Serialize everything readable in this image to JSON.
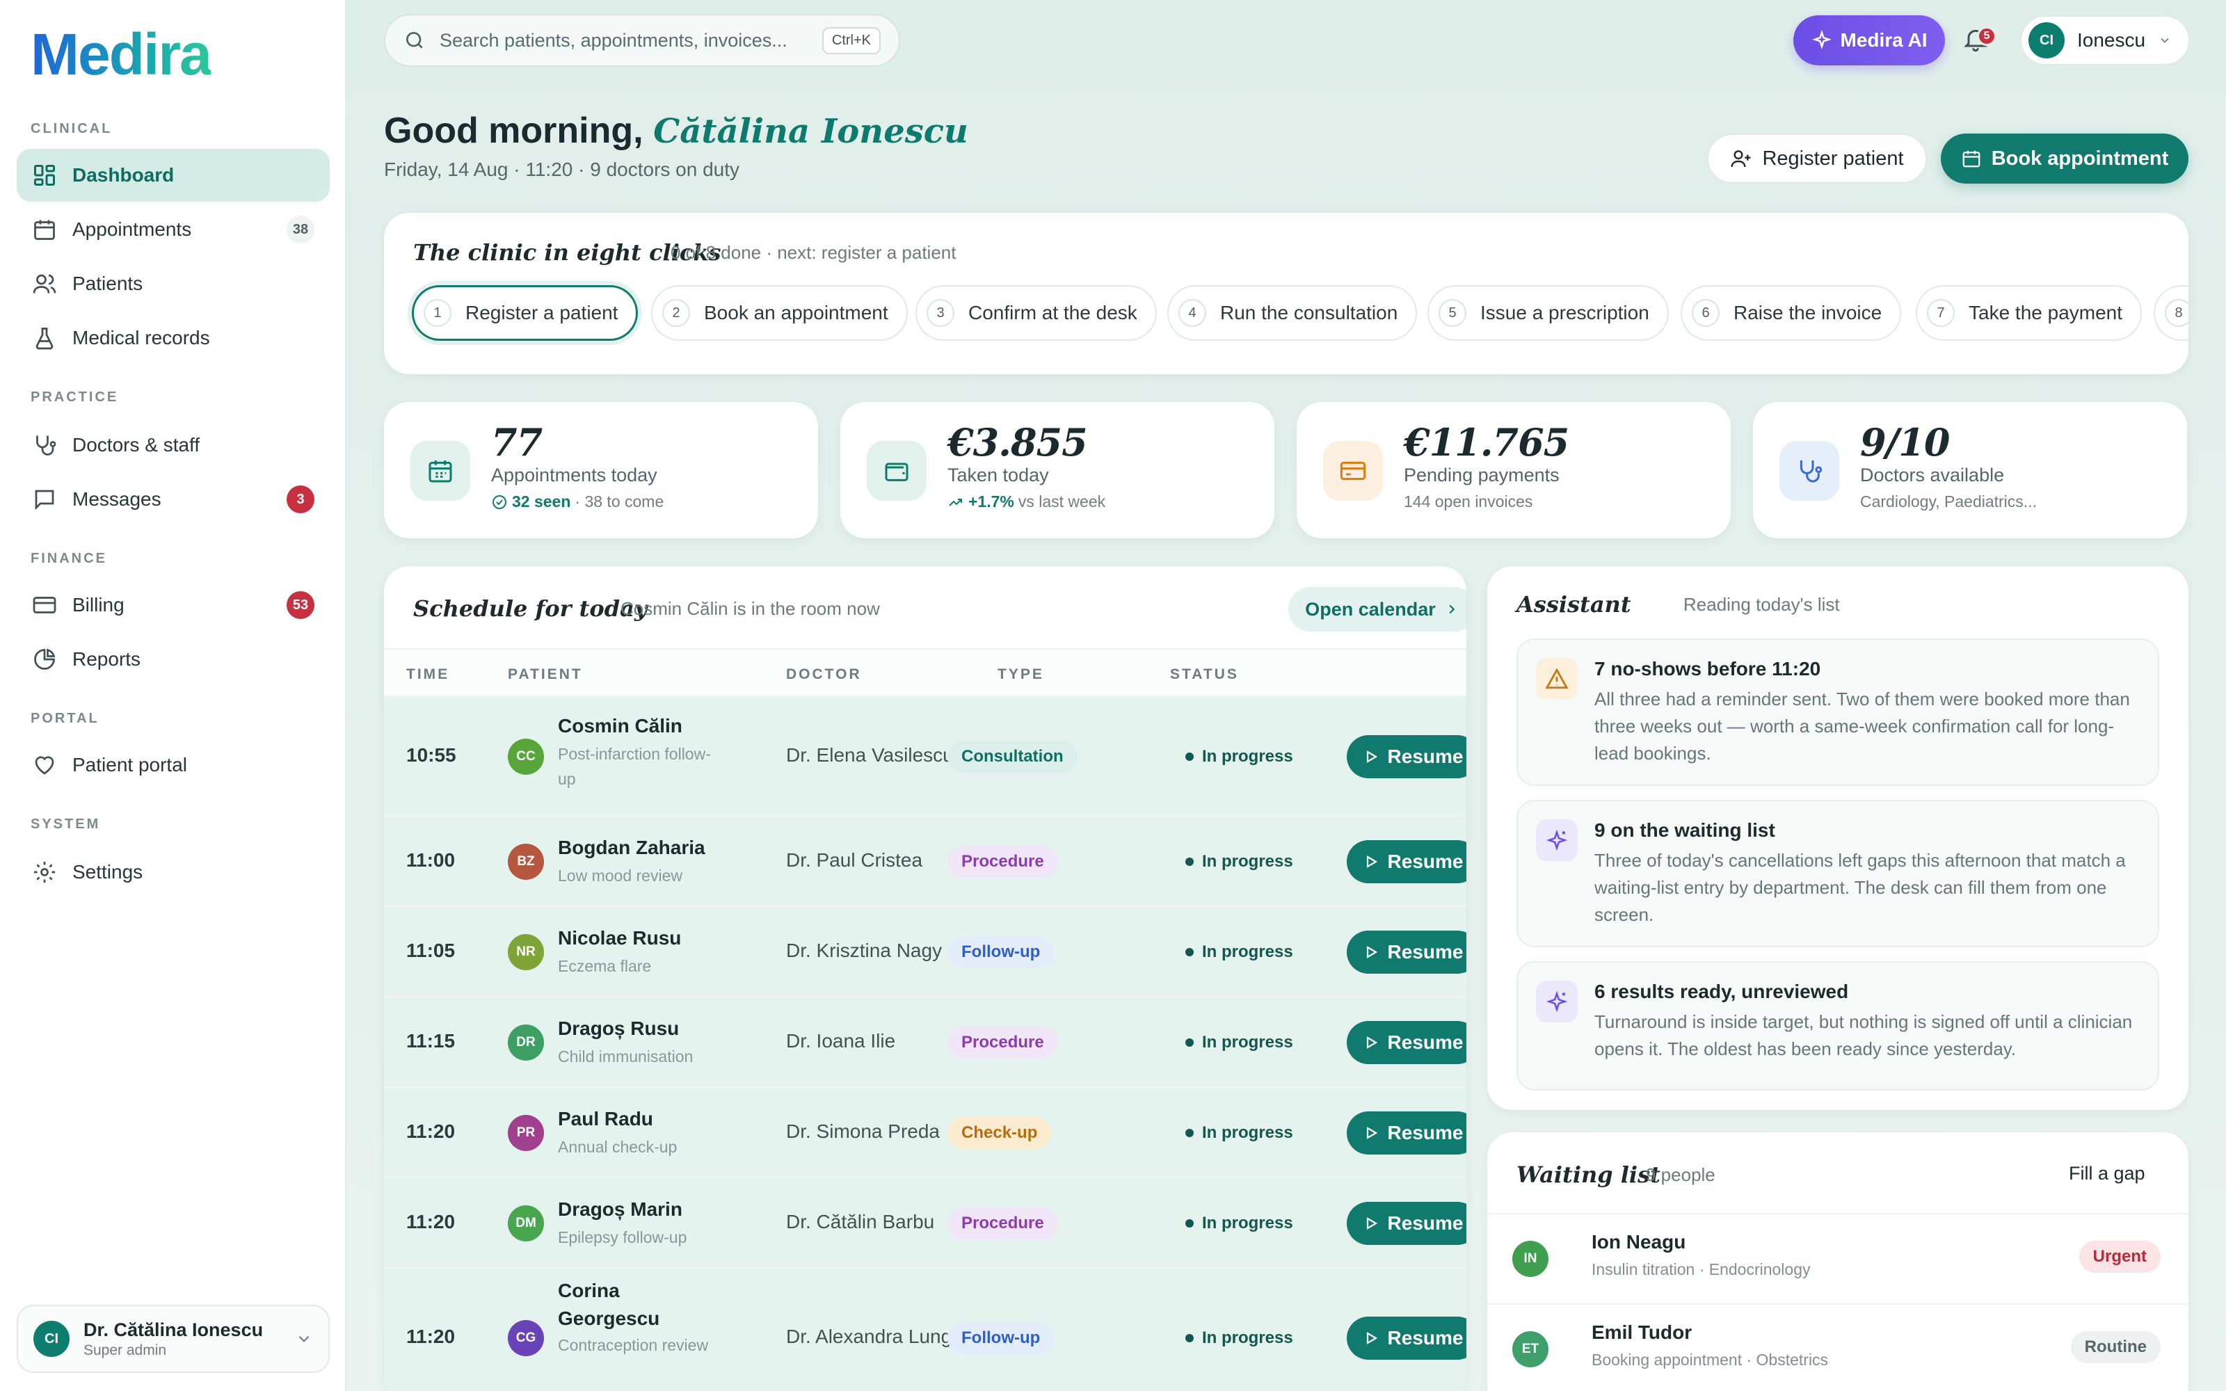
{
  "brand": "Medira",
  "sidebar": {
    "sections": [
      {
        "title": "CLINICAL",
        "items": [
          {
            "label": "Dashboard",
            "icon": "grid-icon",
            "active": true
          },
          {
            "label": "Appointments",
            "icon": "calendar-icon",
            "badge": "38"
          },
          {
            "label": "Patients",
            "icon": "users-icon"
          },
          {
            "label": "Medical records",
            "icon": "flask-icon"
          }
        ]
      },
      {
        "title": "PRACTICE",
        "items": [
          {
            "label": "Doctors & staff",
            "icon": "stethoscope-icon"
          },
          {
            "label": "Messages",
            "icon": "chat-icon",
            "badge": "3"
          }
        ]
      },
      {
        "title": "FINANCE",
        "items": [
          {
            "label": "Billing",
            "icon": "card-icon",
            "badge": "53"
          },
          {
            "label": "Reports",
            "icon": "pie-chart-icon"
          }
        ]
      },
      {
        "title": "PORTAL",
        "items": [
          {
            "label": "Patient portal",
            "icon": "heart-icon"
          }
        ]
      },
      {
        "title": "SYSTEM",
        "items": [
          {
            "label": "Settings",
            "icon": "gear-icon"
          }
        ]
      }
    ],
    "user": {
      "initials": "CI",
      "name": "Dr. Cătălina Ionescu",
      "role": "Super admin"
    }
  },
  "topbar": {
    "search_placeholder": "Search patients, appointments, invoices...",
    "shortcut": "Ctrl+K",
    "ai_label": "Medira AI",
    "notifications": "5",
    "user_initials": "CI",
    "user_name": "Ionescu"
  },
  "greeting": {
    "prefix": "Good morning,",
    "name": "Cătălina Ionescu",
    "subtitle": "Friday, 14 Aug · 11:20 · 9 doctors on duty",
    "register_label": "Register patient",
    "book_label": "Book appointment"
  },
  "steps": {
    "title": "The clinic in eight clicks",
    "subtitle": "0 of 8 done · next: register a patient",
    "items": [
      {
        "num": "1",
        "label": "Register a patient"
      },
      {
        "num": "2",
        "label": "Book an appointment"
      },
      {
        "num": "3",
        "label": "Confirm at the desk"
      },
      {
        "num": "4",
        "label": "Run the consultation"
      },
      {
        "num": "5",
        "label": "Issue a prescription"
      },
      {
        "num": "6",
        "label": "Raise the invoice"
      },
      {
        "num": "7",
        "label": "Take the payment"
      },
      {
        "num": "8",
        "label": ""
      }
    ]
  },
  "kpis": [
    {
      "value": "77",
      "label": "Appointments today",
      "sub_strong": "32 seen",
      "sub": "· 38 to come",
      "icon": "calendar-icon",
      "color": "#0f7a6d",
      "bg": "#e1f1ec"
    },
    {
      "value": "€3.855",
      "label": "Taken today",
      "sub_strong": "+1.7%",
      "sub": "vs last week",
      "icon": "wallet-icon",
      "color": "#0f7a6d",
      "bg": "#e1f1ec"
    },
    {
      "value": "€11.765",
      "label": "Pending payments",
      "sub_strong": "",
      "sub": "144 open invoices",
      "icon": "card-icon",
      "color": "#d97c16",
      "bg": "#fcefdf"
    },
    {
      "value": "9/10",
      "label": "Doctors available",
      "sub_strong": "",
      "sub": "Cardiology, Paediatrics...",
      "icon": "stethoscope-icon",
      "color": "#3569d4",
      "bg": "#e6eefc"
    }
  ],
  "schedule": {
    "title": "Schedule for today",
    "subtitle": "Cosmin Călin is in the room now",
    "open_calendar": "Open calendar",
    "columns": [
      "TIME",
      "PATIENT",
      "DOCTOR",
      "TYPE",
      "STATUS"
    ],
    "rows": [
      {
        "time": "10:55",
        "initials": "CC",
        "avatar_color": "#57a63a",
        "name": "Cosmin Călin",
        "note": "Post-infarction follow-up",
        "doctor": "Dr. Elena Vasilescu",
        "type": "Consultation",
        "type_kind": "consult",
        "status": "In progress",
        "action": "Resume"
      },
      {
        "time": "11:00",
        "initials": "BZ",
        "avatar_color": "#b5583f",
        "name": "Bogdan Zaharia",
        "note": "Low mood review",
        "doctor": "Dr. Paul Cristea",
        "type": "Procedure",
        "type_kind": "proc",
        "status": "In progress",
        "action": "Resume"
      },
      {
        "time": "11:05",
        "initials": "NR",
        "avatar_color": "#7fa539",
        "name": "Nicolae Rusu",
        "note": "Eczema flare",
        "doctor": "Dr. Krisztina Nagy",
        "type": "Follow-up",
        "type_kind": "follow",
        "status": "In progress",
        "action": "Resume"
      },
      {
        "time": "11:15",
        "initials": "DR",
        "avatar_color": "#3e9f63",
        "name": "Dragoș Rusu",
        "note": "Child immunisation",
        "doctor": "Dr. Ioana Ilie",
        "type": "Procedure",
        "type_kind": "proc",
        "status": "In progress",
        "action": "Resume"
      },
      {
        "time": "11:20",
        "initials": "PR",
        "avatar_color": "#a1408e",
        "name": "Paul Radu",
        "note": "Annual check-up",
        "doctor": "Dr. Simona Preda",
        "type": "Check-up",
        "type_kind": "check",
        "status": "In progress",
        "action": "Resume"
      },
      {
        "time": "11:20",
        "initials": "DM",
        "avatar_color": "#48a74e",
        "name": "Dragoș Marin",
        "note": "Epilepsy follow-up",
        "doctor": "Dr. Cătălin Barbu",
        "type": "Procedure",
        "type_kind": "proc",
        "status": "In progress",
        "action": "Resume"
      },
      {
        "time": "11:20",
        "initials": "CG",
        "avatar_color": "#6a43b8",
        "name": "Corina Georgescu",
        "note": "Contraception review",
        "doctor": "Dr. Alexandra Lungu",
        "type": "Follow-up",
        "type_kind": "follow",
        "status": "In progress",
        "action": "Resume"
      }
    ]
  },
  "assistant": {
    "title": "Assistant",
    "subtitle": "Reading today's list",
    "items": [
      {
        "icon": "warning-icon",
        "icon_color": "#c47a14",
        "icon_bg": "#fcefdc",
        "title": "7 no-shows before 11:20",
        "text": "All three had a reminder sent. Two of them were booked more than three weeks out — worth a same-week confirmation call for long-lead bookings."
      },
      {
        "icon": "sparkle-icon",
        "icon_color": "#6b4ee6",
        "icon_bg": "#ece8fb",
        "title": "9 on the waiting list",
        "text": "Three of today's cancellations left gaps this afternoon that match a waiting-list entry by department. The desk can fill them from one screen."
      },
      {
        "icon": "sparkle-icon",
        "icon_color": "#6b4ee6",
        "icon_bg": "#ece8fb",
        "title": "6 results ready, unreviewed",
        "text": "Turnaround is inside target, but nothing is signed off until a clinician opens it. The oldest has been ready since yesterday."
      }
    ]
  },
  "waiting": {
    "title": "Waiting list",
    "subtitle": "9 people",
    "action": "Fill a gap",
    "items": [
      {
        "initials": "IN",
        "avatar_color": "#3f9f4e",
        "name": "Ion Neagu",
        "note": "Insulin titration · Endocrinology",
        "badge": "Urgent",
        "badge_kind": "urgent"
      },
      {
        "initials": "ET",
        "avatar_color": "#3e9f6a",
        "name": "Emil Tudor",
        "note": "Booking appointment · Obstetrics",
        "badge": "Routine",
        "badge_kind": "routine"
      }
    ]
  }
}
